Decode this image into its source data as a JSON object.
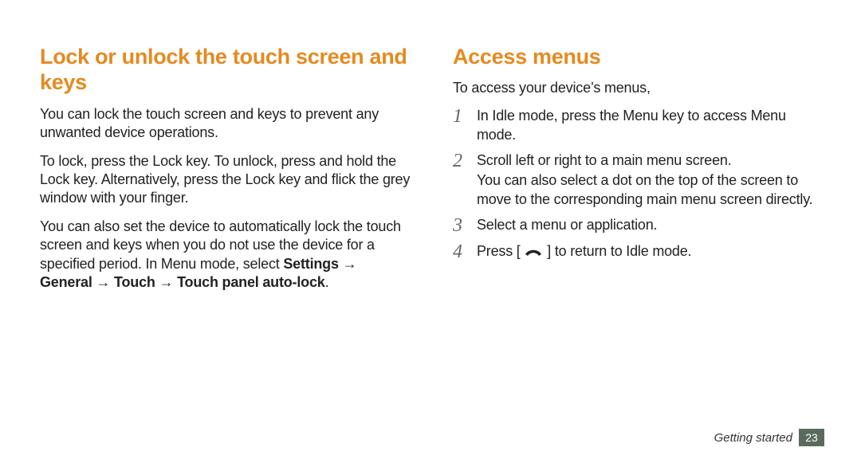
{
  "left": {
    "heading": "Lock or unlock the touch screen and keys",
    "para1": "You can lock the touch screen and keys to prevent any unwanted device operations.",
    "para2": "To lock, press the Lock key. To unlock, press and hold the Lock key. Alternatively, press the Lock key and flick the grey window with your finger.",
    "para3a": "You can also set the device to automatically lock the touch screen and keys when you do not use the device for a specified period. In Menu mode, select ",
    "para3b_bold": "Settings → General → Touch → Touch panel auto-lock",
    "para3c": "."
  },
  "right": {
    "heading": "Access menus",
    "intro": "To access your device’s menus,",
    "step1": "In Idle mode, press the Menu key to access Menu mode.",
    "step2a": "Scroll left or right to a main menu screen.",
    "step2b": "You can also select a dot on the top of the screen to move to the corresponding main menu screen directly.",
    "step3": "Select a menu or application.",
    "step4a": "Press [",
    "step4b": "] to return to Idle mode."
  },
  "footer": {
    "section": "Getting started",
    "page": "23"
  }
}
